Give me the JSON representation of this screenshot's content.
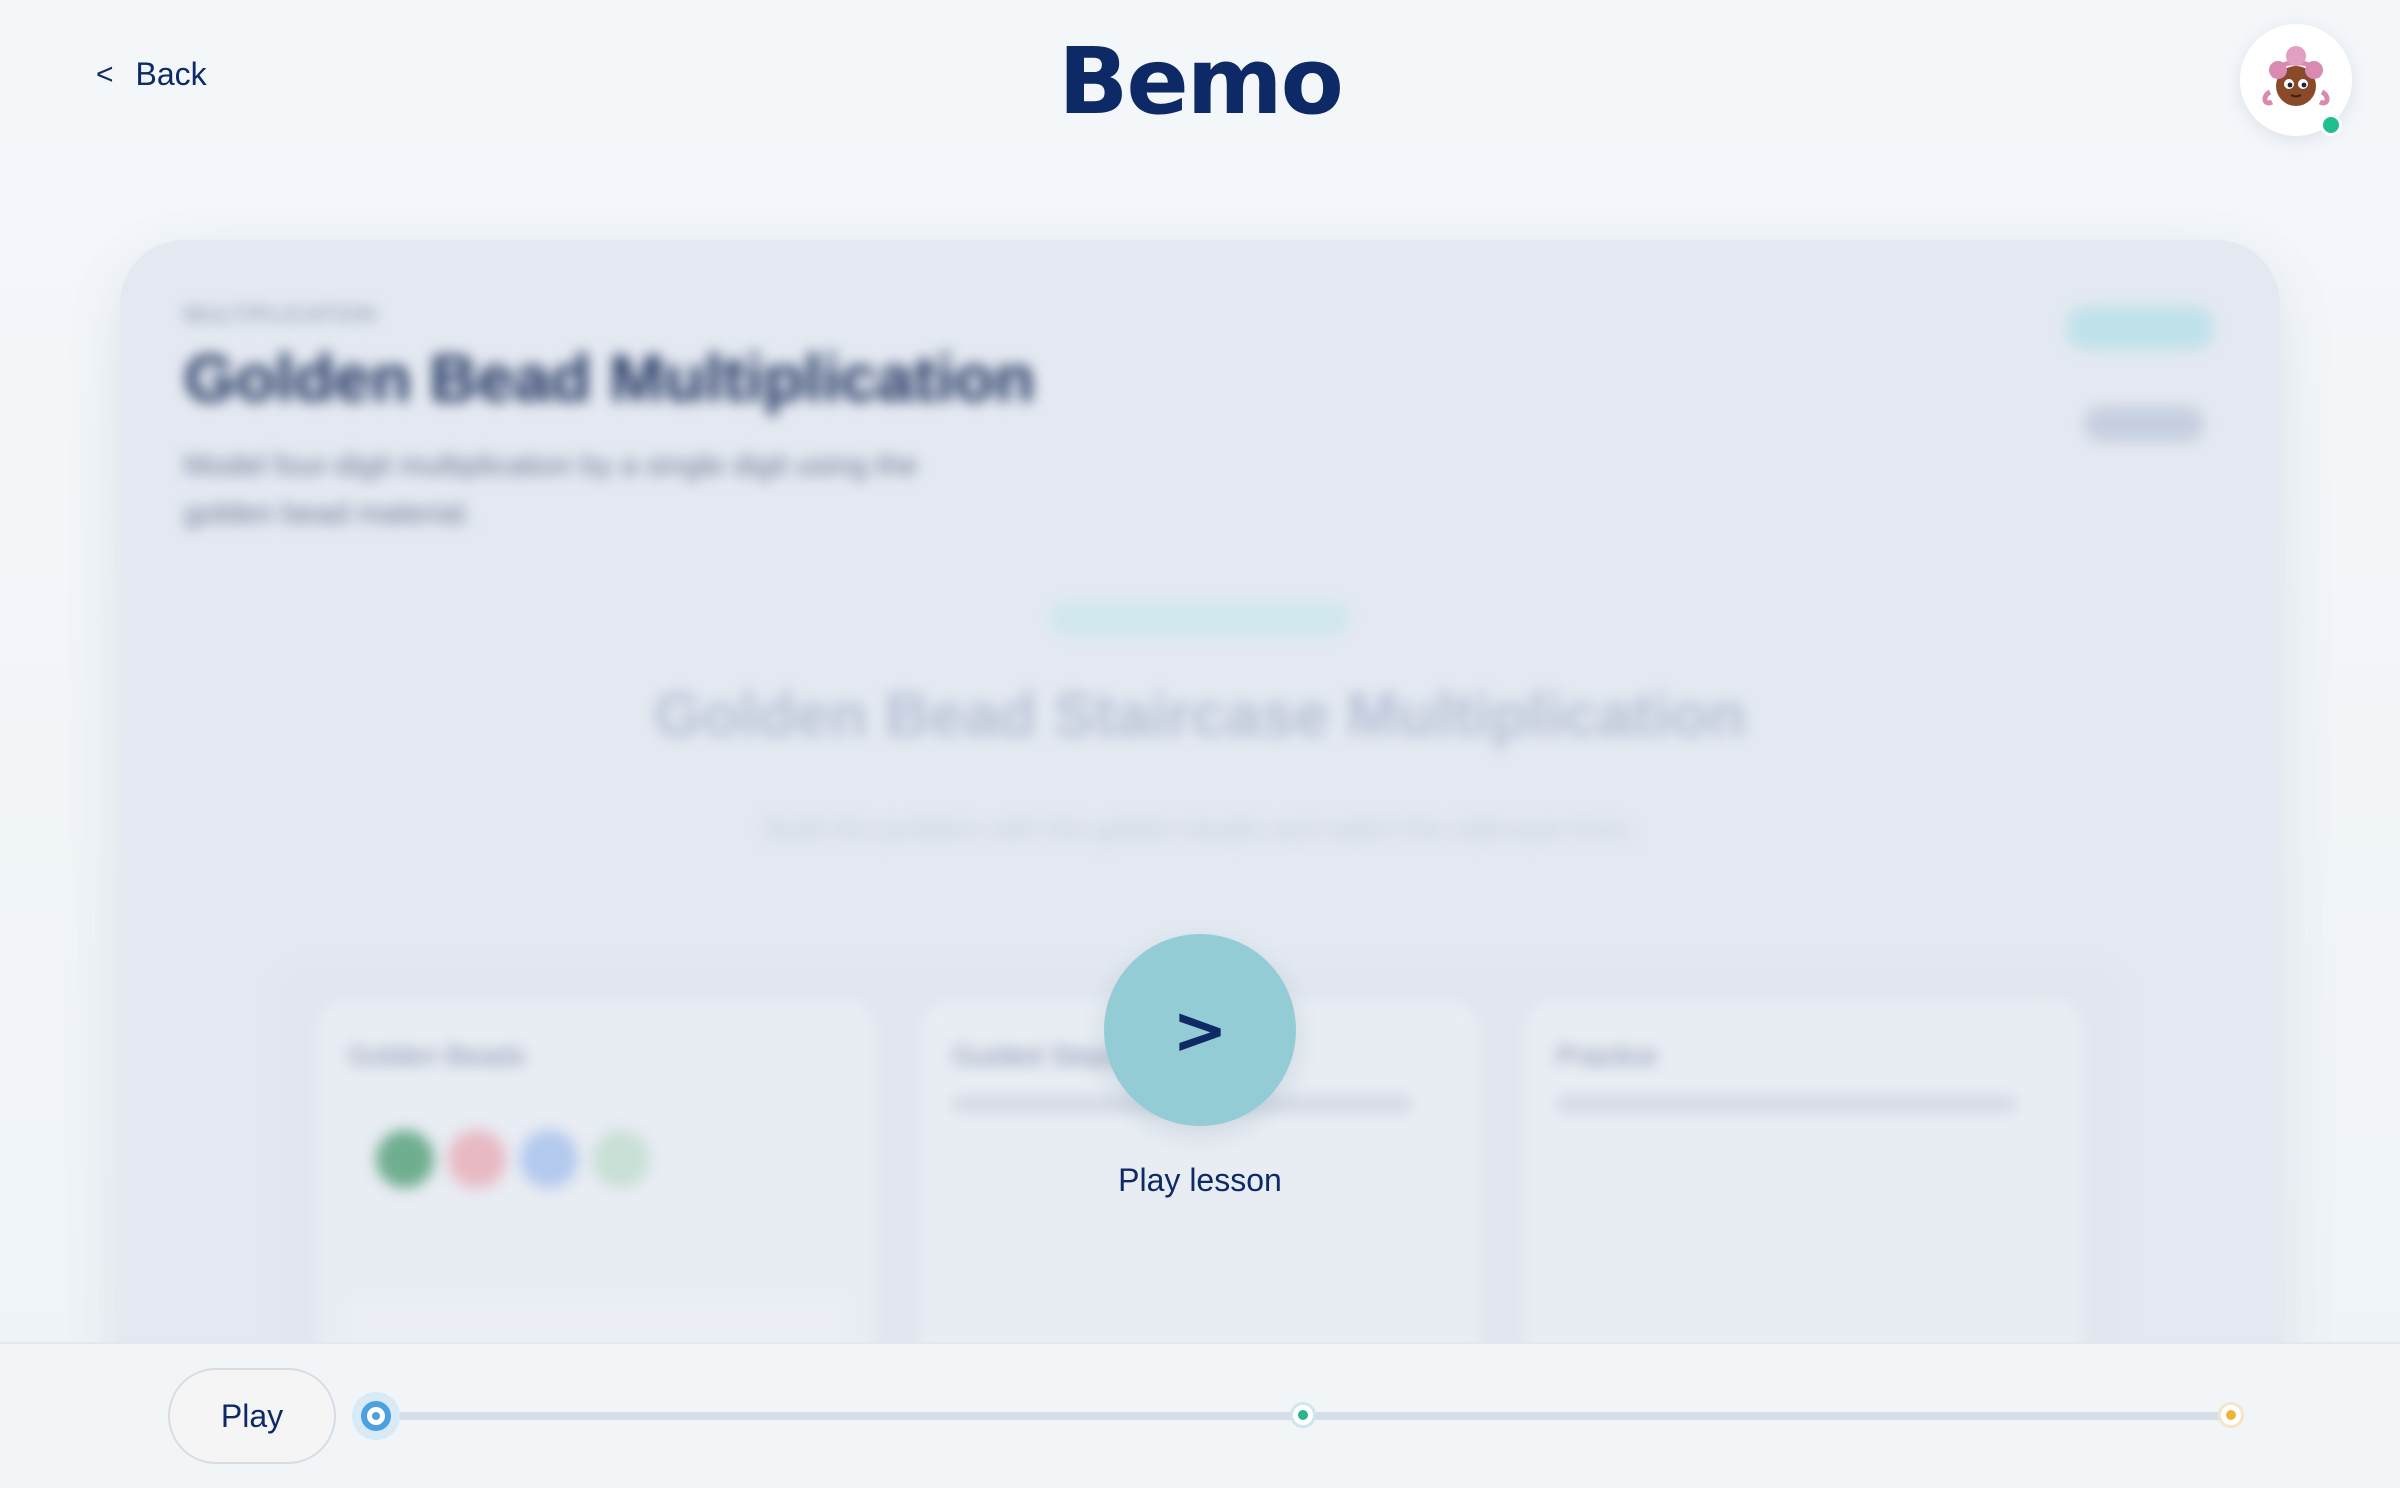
{
  "header": {
    "back_chevron": "<",
    "back_label": "Back",
    "brand": "Bemo",
    "avatar_icon": "girl-avatar-icon",
    "status_color": "#1fbf8f"
  },
  "lesson": {
    "eyebrow": "MULTIPLICATION",
    "title": "Golden Bead Multiplication",
    "description": "Model four-digit multiplication by a single digit using the golden bead material.",
    "center_title": "Golden Bead Staircase Multiplication",
    "center_text": "Build the problem with the golden beads and watch the staircase form.",
    "panels": [
      "Golden Beads",
      "Guided Steps",
      "Practice"
    ],
    "bead_colors": [
      "#6fae8f",
      "#e8b9c3",
      "#b3c9ee",
      "#c9e0d6"
    ]
  },
  "overlay": {
    "play_glyph": ">",
    "play_label": "Play lesson",
    "accent": "#94ccd6"
  },
  "player": {
    "play_label": "Play",
    "progress": 0.0,
    "markers": [
      {
        "name": "start",
        "color": "#4ea0dc"
      },
      {
        "name": "middle",
        "color": "#2ab38f"
      },
      {
        "name": "end",
        "color": "#f0b336"
      }
    ]
  }
}
